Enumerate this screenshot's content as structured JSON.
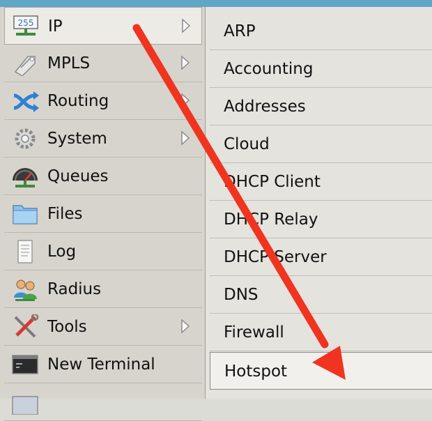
{
  "main_menu": {
    "items": [
      {
        "icon": "ip-icon",
        "label": "IP",
        "has_submenu": true
      },
      {
        "icon": "mpls-icon",
        "label": "MPLS",
        "has_submenu": true
      },
      {
        "icon": "routing-icon",
        "label": "Routing",
        "has_submenu": true
      },
      {
        "icon": "system-gear-icon",
        "label": "System",
        "has_submenu": true
      },
      {
        "icon": "queues-gauge-icon",
        "label": "Queues",
        "has_submenu": false
      },
      {
        "icon": "folder-icon",
        "label": "Files",
        "has_submenu": false
      },
      {
        "icon": "log-document-icon",
        "label": "Log",
        "has_submenu": false
      },
      {
        "icon": "radius-users-icon",
        "label": "Radius",
        "has_submenu": false
      },
      {
        "icon": "tools-icon",
        "label": "Tools",
        "has_submenu": true
      },
      {
        "icon": "terminal-icon",
        "label": "New Terminal",
        "has_submenu": false
      }
    ],
    "active": "IP"
  },
  "ip_submenu": {
    "items": [
      "ARP",
      "Accounting",
      "Addresses",
      "Cloud",
      "DHCP Client",
      "DHCP Relay",
      "DHCP Server",
      "DNS",
      "Firewall",
      "Hotspot"
    ],
    "highlighted": "Hotspot"
  },
  "ip_icon_text": "255",
  "colors": {
    "annotation_arrow": "#f0341f",
    "top_bar": "#5fa6c9"
  }
}
